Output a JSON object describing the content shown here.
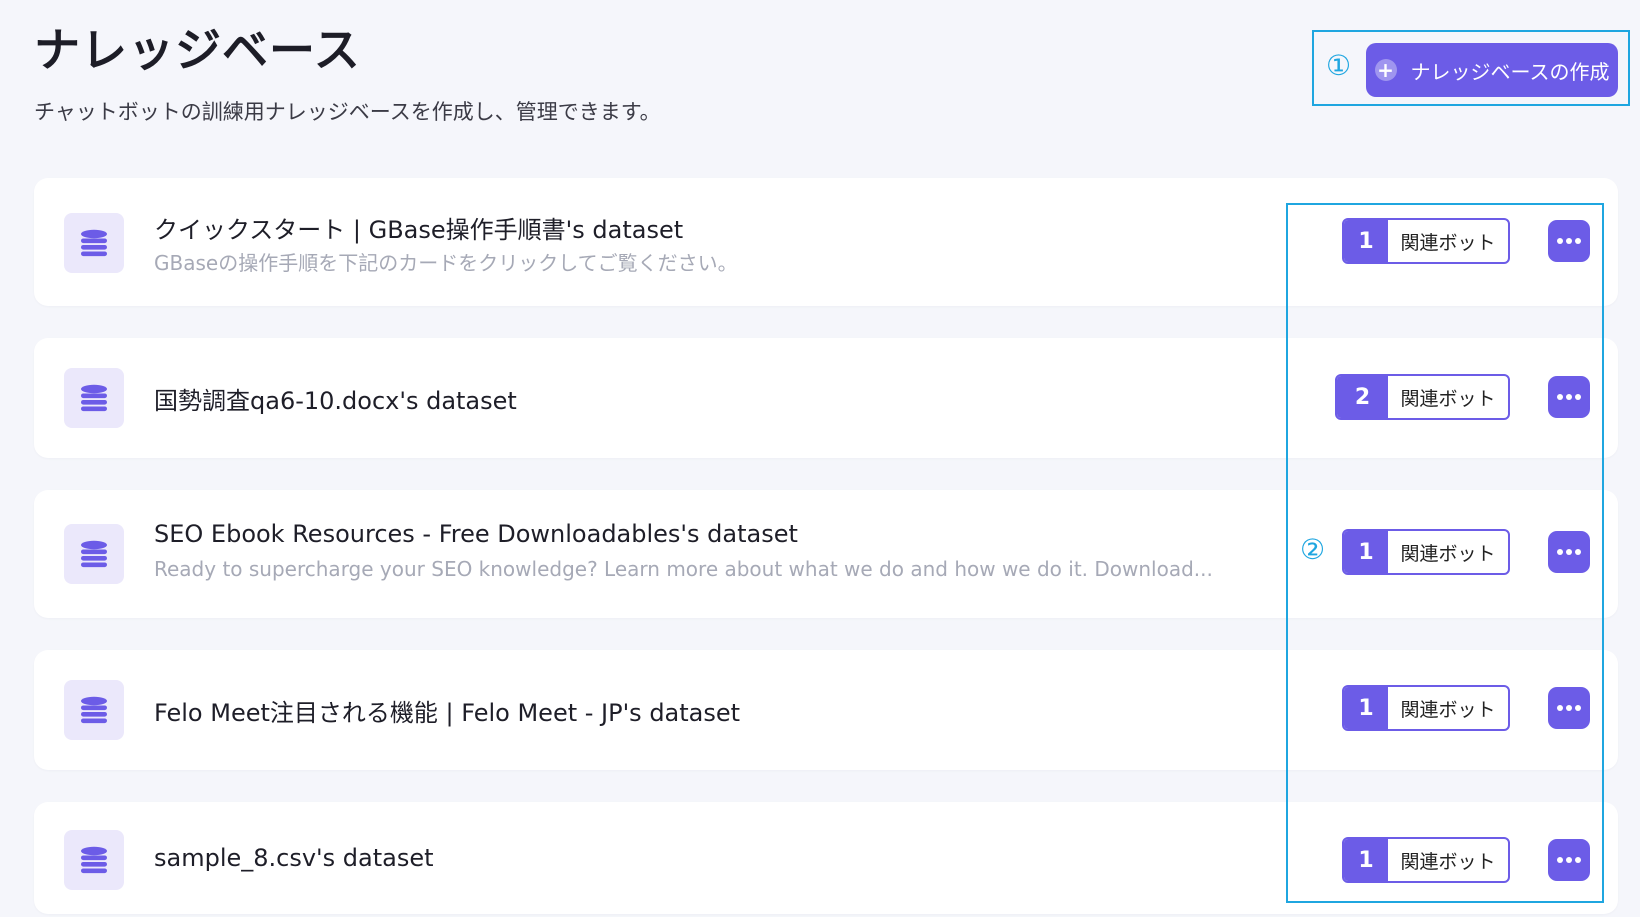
{
  "header": {
    "title": "ナレッジベース",
    "subtitle": "チャットボットの訓練用ナレッジベースを作成し、管理できます。",
    "create_button_label": "ナレッジベースの作成"
  },
  "annotations": {
    "marker_1": "①",
    "marker_2": "②"
  },
  "datasets": [
    {
      "name": "クイックスタート | GBase操作手順書's dataset",
      "description": "GBaseの操作手順を下記のカードをクリックしてご覧ください。",
      "related_bot_count": "1",
      "related_bot_label": "関連ボット"
    },
    {
      "name": "国勢調査qa6-10.docx's dataset",
      "description": "",
      "related_bot_count": "2",
      "related_bot_label": "関連ボット"
    },
    {
      "name": "SEO Ebook Resources - Free Downloadables's dataset",
      "description": "Ready to supercharge your SEO knowledge? Learn more about what we do and how we do it. Download...",
      "related_bot_count": "1",
      "related_bot_label": "関連ボット"
    },
    {
      "name": "Felo Meet注目される機能 | Felo Meet - JP's dataset",
      "description": "",
      "related_bot_count": "1",
      "related_bot_label": "関連ボット"
    },
    {
      "name": "sample_8.csv's dataset",
      "description": "",
      "related_bot_count": "1",
      "related_bot_label": "関連ボット"
    }
  ],
  "icons": {
    "dataset": "database-icon",
    "more": "more-horizontal-icon",
    "create": "plus-circle-icon"
  },
  "colors": {
    "accent": "#6c5ce7",
    "annotation": "#1fa6e0",
    "icon_bg": "#ebe8fb"
  }
}
